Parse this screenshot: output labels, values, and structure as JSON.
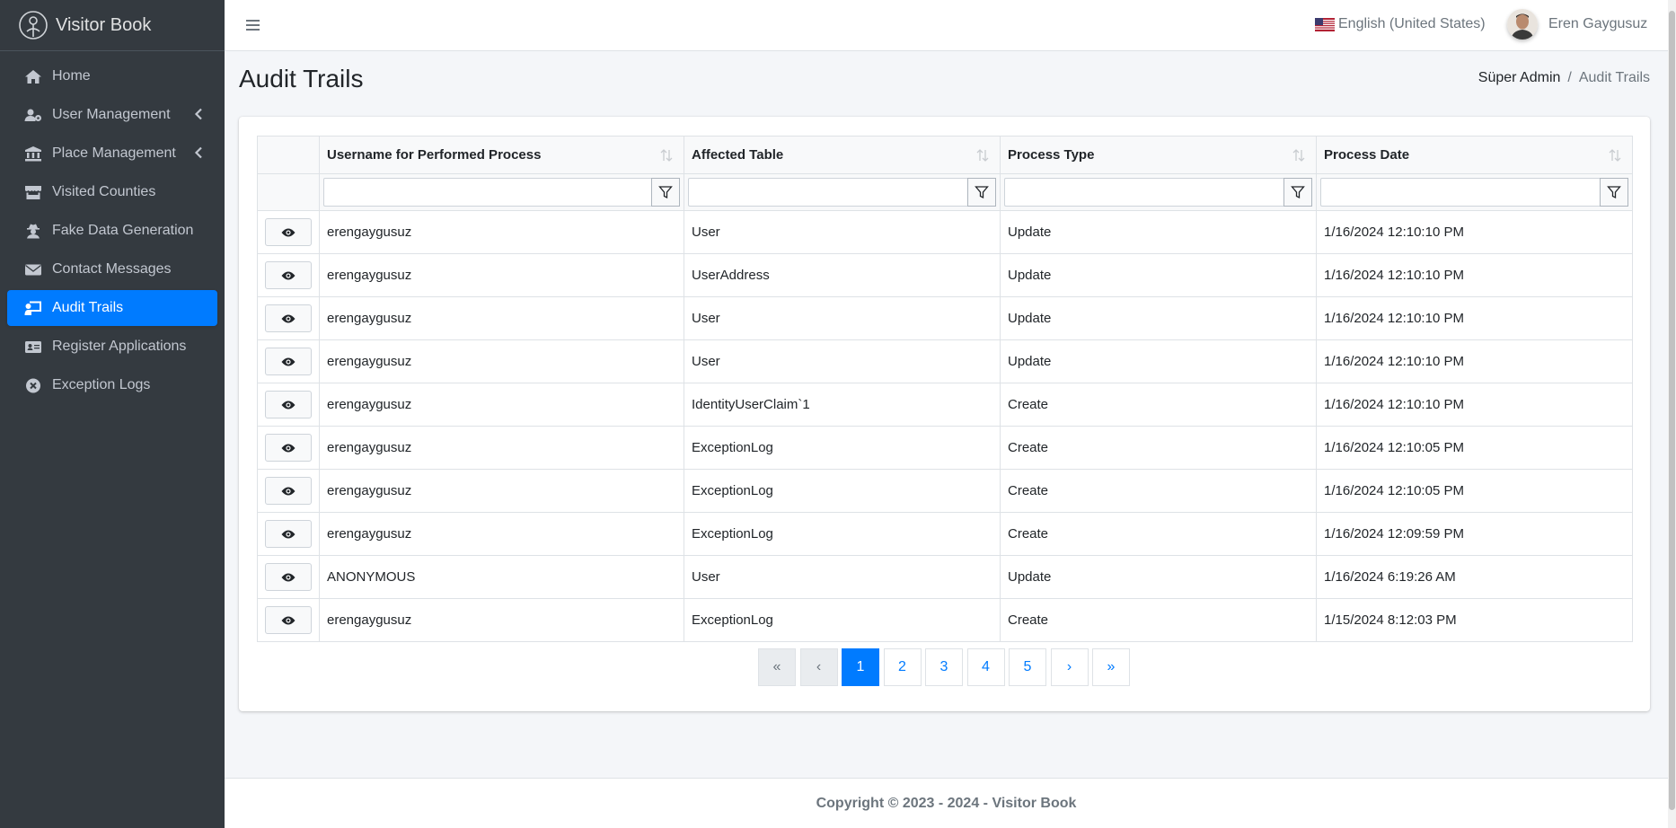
{
  "app": {
    "brand": "Visitor Book"
  },
  "sidebar": {
    "items": [
      {
        "label": "Home",
        "icon": "home-icon"
      },
      {
        "label": "User Management",
        "icon": "users-cog-icon",
        "has_children": true
      },
      {
        "label": "Place Management",
        "icon": "landmark-icon",
        "has_children": true
      },
      {
        "label": "Visited Counties",
        "icon": "store-icon"
      },
      {
        "label": "Fake Data Generation",
        "icon": "user-secret-icon"
      },
      {
        "label": "Contact Messages",
        "icon": "envelope-icon"
      },
      {
        "label": "Audit Trails",
        "icon": "chalkboard-teacher-icon",
        "active": true
      },
      {
        "label": "Register Applications",
        "icon": "id-card-icon"
      },
      {
        "label": "Exception Logs",
        "icon": "times-circle-icon"
      }
    ]
  },
  "header": {
    "language": "English (United States)",
    "user_name": "Eren Gaygusuz"
  },
  "page": {
    "title": "Audit Trails",
    "breadcrumb": [
      "Süper Admin",
      "Audit Trails"
    ]
  },
  "table": {
    "columns": [
      "Username for Performed Process",
      "Affected Table",
      "Process Type",
      "Process Date"
    ],
    "rows": [
      [
        "erengaygusuz",
        "User",
        "Update",
        "1/16/2024 12:10:10 PM"
      ],
      [
        "erengaygusuz",
        "UserAddress",
        "Update",
        "1/16/2024 12:10:10 PM"
      ],
      [
        "erengaygusuz",
        "User",
        "Update",
        "1/16/2024 12:10:10 PM"
      ],
      [
        "erengaygusuz",
        "User",
        "Update",
        "1/16/2024 12:10:10 PM"
      ],
      [
        "erengaygusuz",
        "IdentityUserClaim`1",
        "Create",
        "1/16/2024 12:10:10 PM"
      ],
      [
        "erengaygusuz",
        "ExceptionLog",
        "Create",
        "1/16/2024 12:10:05 PM"
      ],
      [
        "erengaygusuz",
        "ExceptionLog",
        "Create",
        "1/16/2024 12:10:05 PM"
      ],
      [
        "erengaygusuz",
        "ExceptionLog",
        "Create",
        "1/16/2024 12:09:59 PM"
      ],
      [
        "ANONYMOUS",
        "User",
        "Update",
        "1/16/2024 6:19:26 AM"
      ],
      [
        "erengaygusuz",
        "ExceptionLog",
        "Create",
        "1/15/2024 8:12:03 PM"
      ]
    ]
  },
  "pagination": {
    "first": "«",
    "prev": "‹",
    "pages": [
      "1",
      "2",
      "3",
      "4",
      "5"
    ],
    "current": "1",
    "next": "›",
    "last": "»"
  },
  "footer": {
    "text": "Copyright © 2023 - 2024 - Visitor Book"
  },
  "colors": {
    "sidebar_bg": "#343a40",
    "accent": "#007bff",
    "page_bg": "#f4f6f9"
  }
}
